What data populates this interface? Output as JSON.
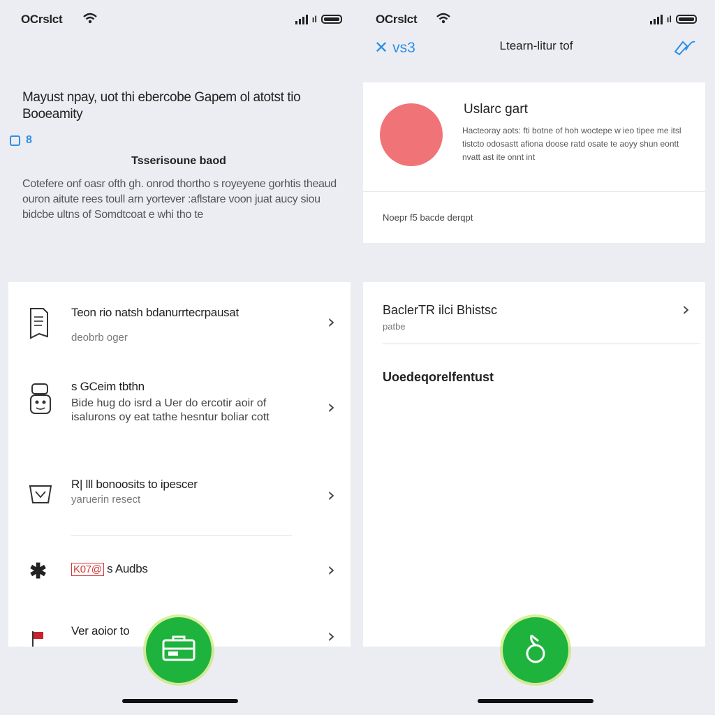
{
  "left_screen": {
    "status": {
      "time": "OCrslct"
    },
    "intro": {
      "title": "Mayust npay, uot thi ebercobe Gapem ol atotst tio Booeamity",
      "checkbox_label": "8",
      "sub_heading": "Tsserisoune baod",
      "body": "Cotefere onf oasr ofth gh. onrod thortho s royeyene gorhtis theaud ouron aitute rees toull arn yortever :aflstare voon juat aucy siou bidcbe ultns of Somdtcoat e whi tho te"
    },
    "list": [
      {
        "icon": "document-icon",
        "title": "Teon rio natsh bdanurrtecrpausat",
        "subtitle": "deobrb oger"
      },
      {
        "icon": "robot-icon",
        "title": "s GCeim tbthn",
        "subtitle": "Bide hug do isrd a Uer do ercotir aoir of isalurons oy eat tathe hesntur boliar cott"
      },
      {
        "icon": "basket-icon",
        "title": "R| lll bonoosits to ipescer",
        "subtitle": "yaruerin resect"
      },
      {
        "icon": "asterisk-icon",
        "badge": "K07@",
        "title": "s Audbs",
        "subtitle": ""
      },
      {
        "icon": "flag-icon",
        "title": "Ver aoior to",
        "subtitle": ""
      }
    ],
    "fab_icon": "briefcase-icon"
  },
  "right_screen": {
    "status": {
      "time": "OCrslct"
    },
    "nav": {
      "back_label": "vs3",
      "title": "Ltearn-litur tof",
      "action_icon": "edit-icon"
    },
    "profile": {
      "name": "Uslarc gart",
      "description": "Hacteoray aots: fti botne of hoh woctepe w ieo tipee me itsl tistcto odosastt afiona doose ratd osate te aoyy shun eontt nvatt ast ite onnt int",
      "footer": "Noepr f5 bacde derqpt"
    },
    "detail": {
      "title": "BaclerTR ilci Bhistsc",
      "subtitle": "patbe",
      "heading": "Uoedeqorelfentust"
    },
    "fab_icon": "leaf-icon"
  },
  "colors": {
    "accent": "#2a8fe8",
    "fab": "#1eb33c",
    "avatar": "#f07378",
    "background": "#ecedf2"
  }
}
